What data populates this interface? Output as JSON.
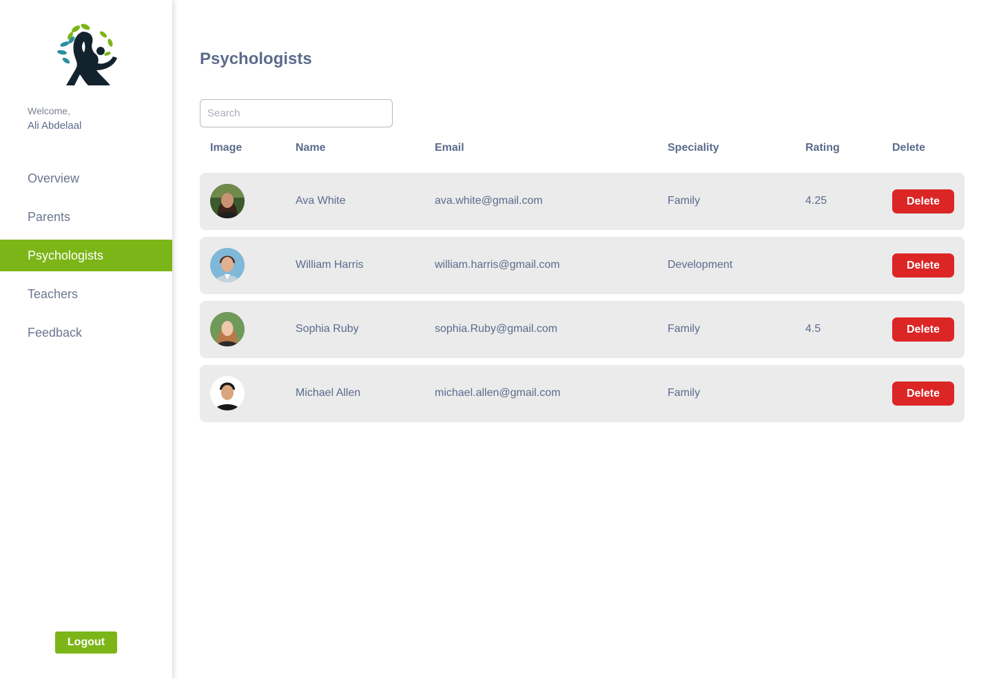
{
  "sidebar": {
    "welcome_label": "Welcome,",
    "user_name": "Ali Abdelaal",
    "nav": [
      {
        "label": "Overview",
        "active": false
      },
      {
        "label": "Parents",
        "active": false
      },
      {
        "label": "Psychologists",
        "active": true
      },
      {
        "label": "Teachers",
        "active": false
      },
      {
        "label": "Feedback",
        "active": false
      }
    ],
    "logout_label": "Logout"
  },
  "main": {
    "title": "Psychologists",
    "search": {
      "placeholder": "Search",
      "value": ""
    },
    "columns": [
      "Image",
      "Name",
      "Email",
      "Speciality",
      "Rating",
      "Delete"
    ],
    "rows": [
      {
        "name": "Ava White",
        "email": "ava.white@gmail.com",
        "speciality": "Family",
        "rating": "4.25",
        "delete_label": "Delete"
      },
      {
        "name": "William Harris",
        "email": "william.harris@gmail.com",
        "speciality": "Development",
        "rating": "",
        "delete_label": "Delete"
      },
      {
        "name": "Sophia Ruby",
        "email": "sophia.Ruby@gmail.com",
        "speciality": "Family",
        "rating": "4.5",
        "delete_label": "Delete"
      },
      {
        "name": "Michael Allen",
        "email": "michael.allen@gmail.com",
        "speciality": "Family",
        "rating": "",
        "delete_label": "Delete"
      }
    ]
  },
  "colors": {
    "accent": "#7cb518",
    "danger": "#dc2626",
    "text": "#5b6b8c",
    "row_bg": "#ebebeb"
  },
  "icons": [
    "logo-icon",
    "avatar-ava-white",
    "avatar-william-harris",
    "avatar-sophia-ruby",
    "avatar-michael-allen"
  ]
}
